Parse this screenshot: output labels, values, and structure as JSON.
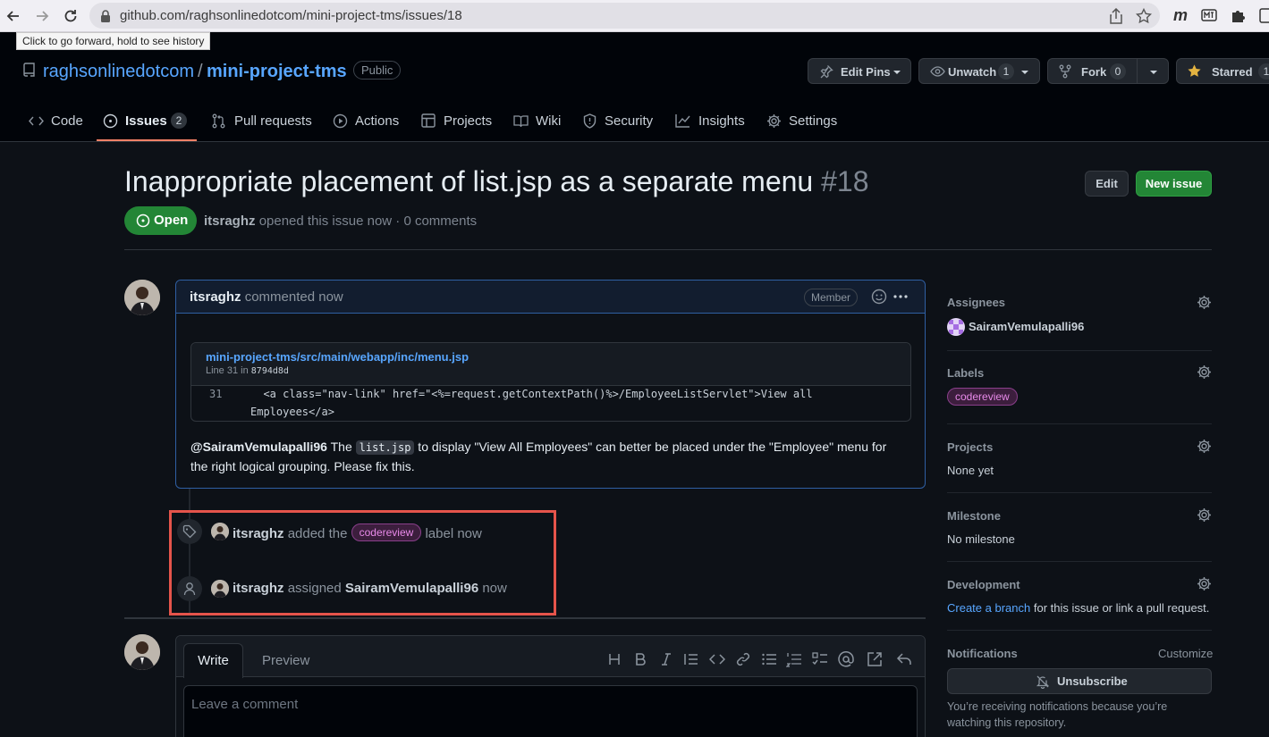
{
  "browser": {
    "url": "github.com/raghsonlinedotcom/mini-project-tms/issues/18",
    "tooltip": "Click to go forward, hold to see history"
  },
  "repo": {
    "owner": "raghsonlinedotcom",
    "separator": "/",
    "name": "mini-project-tms",
    "visibility": "Public",
    "edit_pins_label": "Edit Pins",
    "unwatch_label": "Unwatch",
    "watch_count": "1",
    "fork_label": "Fork",
    "fork_count": "0",
    "starred_label": "Starred",
    "star_count": "1"
  },
  "tabs": [
    {
      "label": "Code",
      "icon": "code-icon"
    },
    {
      "label": "Issues",
      "icon": "issue-icon",
      "count": "2",
      "selected": true
    },
    {
      "label": "Pull requests",
      "icon": "pull-request-icon"
    },
    {
      "label": "Actions",
      "icon": "play-icon"
    },
    {
      "label": "Projects",
      "icon": "table-icon"
    },
    {
      "label": "Wiki",
      "icon": "book-icon"
    },
    {
      "label": "Security",
      "icon": "shield-icon"
    },
    {
      "label": "Insights",
      "icon": "graph-icon"
    },
    {
      "label": "Settings",
      "icon": "gear-icon"
    }
  ],
  "issue": {
    "title": "Inappropriate placement of list.jsp as a separate menu",
    "number": "#18",
    "state": "Open",
    "author": "itsraghz",
    "meta_rest": "opened this issue now · 0 comments",
    "edit_label": "Edit",
    "new_issue_label": "New issue"
  },
  "comment": {
    "author": "itsraghz",
    "action": "commented now",
    "badge": "Member",
    "permalink": {
      "path": "mini-project-tms/src/main/webapp/inc/menu.jsp",
      "line_info": "Line 31 in",
      "commit": "8794d8d",
      "line_number": "31",
      "code_line1": "  <a class=\"nav-link\" href=\"<%=request.getContextPath()%>/EmployeeListServlet\">View all",
      "code_line2": "Employees</a>"
    },
    "mention": "@SairamVemulapalli96",
    "body_before": " The ",
    "body_code": "list.jsp",
    "body_after": " to display \"View All Employees\" can better be placed under the \"Employee\" menu for the right logical grouping. Please fix this."
  },
  "timeline": [
    {
      "actor": "itsraghz",
      "pre": "added the",
      "label": "codereview",
      "post": "label now",
      "icon": "tag-icon"
    },
    {
      "actor": "itsraghz",
      "pre": "assigned",
      "target": "SairamVemulapalli96",
      "post": "now",
      "icon": "person-icon"
    }
  ],
  "sidebar": {
    "assignees": {
      "title": "Assignees",
      "value": "SairamVemulapalli96"
    },
    "labels": {
      "title": "Labels",
      "value": "codereview"
    },
    "projects": {
      "title": "Projects",
      "value": "None yet"
    },
    "milestone": {
      "title": "Milestone",
      "value": "No milestone"
    },
    "development": {
      "title": "Development",
      "link": "Create a branch",
      "rest": "for this issue or link a pull request."
    },
    "notifications": {
      "title": "Notifications",
      "customize": "Customize",
      "button": "Unsubscribe",
      "note": "You’re receiving notifications because you’re watching this repository."
    }
  },
  "editor": {
    "write_tab": "Write",
    "preview_tab": "Preview",
    "placeholder": "Leave a comment",
    "toolbar": [
      "heading-icon",
      "bold-icon",
      "italic-icon",
      "quote-icon",
      "code-icon",
      "link-icon",
      "bulleted-list-icon",
      "numbered-list-icon",
      "task-list-icon",
      "mention-icon",
      "cross-reference-icon",
      "reply-icon"
    ]
  },
  "colors": {
    "accent_link": "#58a6ff",
    "open_green": "#238636",
    "highlight_box": "#e5544b",
    "label_pink": "#e88ae9"
  }
}
